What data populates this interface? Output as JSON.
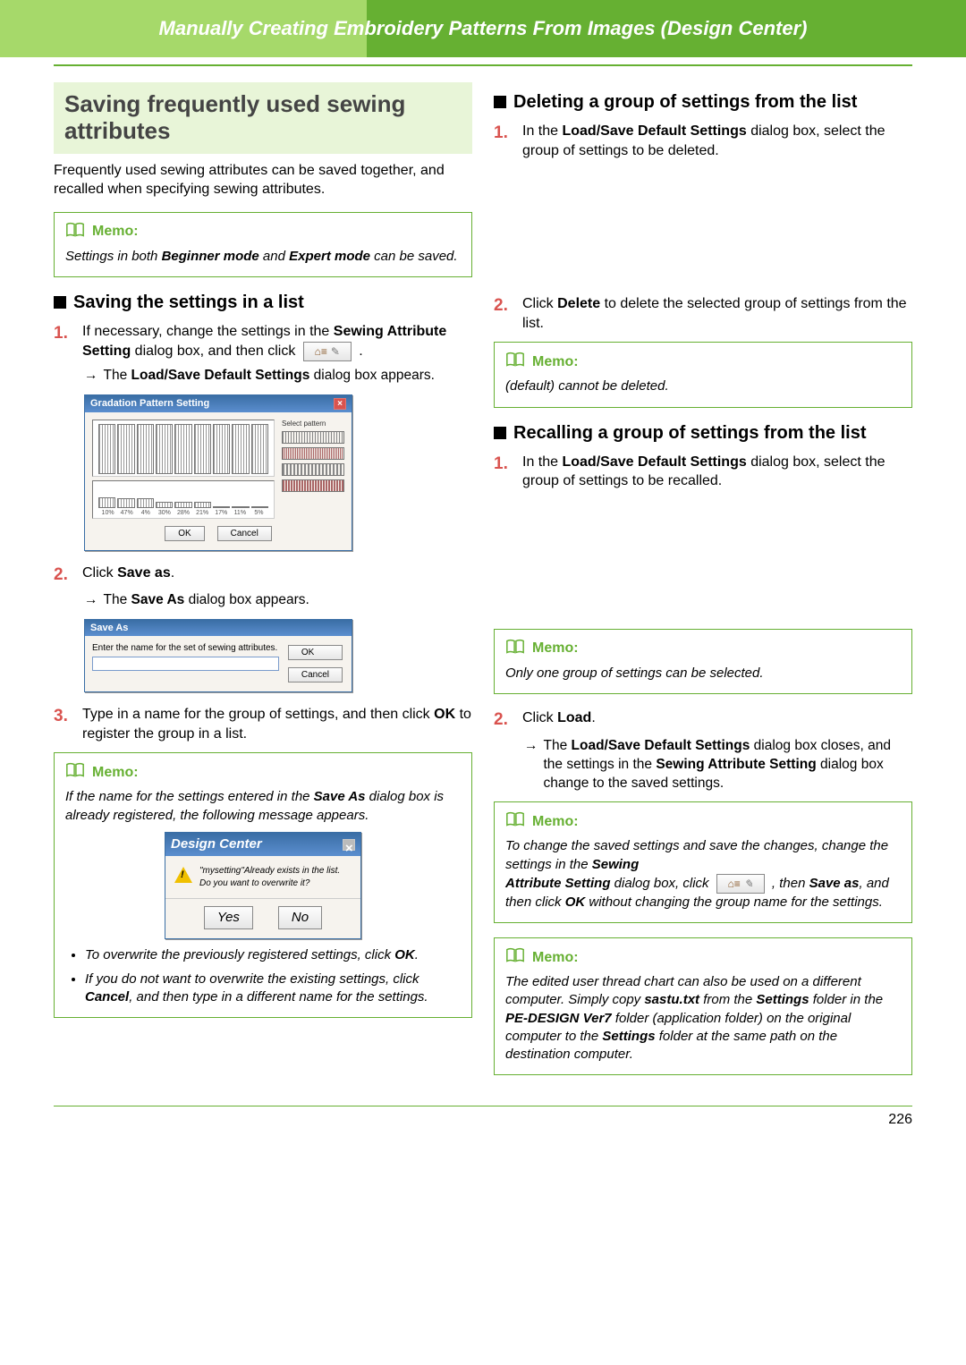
{
  "header": {
    "title": "Manually Creating Embroidery Patterns From Images (Design Center)"
  },
  "left": {
    "section_title": "Saving frequently used sewing attributes",
    "intro": "Frequently used sewing attributes can be saved together, and recalled when specifying sewing attributes.",
    "memo1_label": "Memo:",
    "memo1_body_pre": "Settings in both ",
    "memo1_b1": "Beginner mode",
    "memo1_mid": " and ",
    "memo1_b2": "Expert mode",
    "memo1_body_post": " can be saved.",
    "sub_save": "Saving the settings in a list",
    "step1_pre": "If necessary, change the settings in the ",
    "step1_b": "Sewing Attribute Setting",
    "step1_post": " dialog box, and then click ",
    "step1_tail": " .",
    "result1_pre": "The ",
    "result1_b": "Load/Save Default Settings",
    "result1_post": " dialog box appears.",
    "grad_title": "Gradation Pattern Setting",
    "grad_side_label": "Select pattern",
    "grad_labels": [
      "10%",
      "47%",
      "4%",
      "30%",
      "28%",
      "21%",
      "17%",
      "11%",
      "5%"
    ],
    "grad_ok": "OK",
    "grad_cancel": "Cancel",
    "step2_pre": "Click ",
    "step2_b": "Save as",
    "step2_post": ".",
    "result2_pre": "The ",
    "result2_b": "Save As",
    "result2_post": " dialog box appears.",
    "saveas_title": "Save As",
    "saveas_prompt": "Enter the name for the set of sewing attributes.",
    "saveas_ok": "OK",
    "saveas_cancel": "Cancel",
    "step3_pre": "Type in a name for the group of settings, and then click ",
    "step3_b": "OK",
    "step3_post": " to register the group in a list.",
    "memo2_label": "Memo:",
    "memo2_p1_pre": "If the name for the settings entered in the ",
    "memo2_p1_b": "Save As",
    "memo2_p1_post": " dialog box is already registered, the following message appears.",
    "dc_title": "Design Center",
    "dc_msg": "\"mysetting\"Already exists in the list. Do you want to overwrite it?",
    "dc_yes": "Yes",
    "dc_no": "No",
    "memo2_li1_pre": "To overwrite the previously registered settings, click ",
    "memo2_li1_b": "OK",
    "memo2_li1_post": ".",
    "memo2_li2_pre": "If you do not want to overwrite the existing settings, click ",
    "memo2_li2_b": "Cancel",
    "memo2_li2_post": ", and then type in a different name for the settings."
  },
  "right": {
    "sub_delete": "Deleting a group of settings from the list",
    "d_step1_pre": "In the ",
    "d_step1_b": "Load/Save Default Settings",
    "d_step1_post": " dialog box, select the group of settings to be deleted.",
    "d_step2_pre": "Click ",
    "d_step2_b": "Delete",
    "d_step2_post": " to delete the selected group of settings from the list.",
    "memo3_label": "Memo:",
    "memo3_body": "(default) cannot be deleted.",
    "sub_recall": "Recalling a group of settings from the list",
    "r_step1_pre": "In the ",
    "r_step1_b": "Load/Save Default Settings",
    "r_step1_post": " dialog box, select the group of settings to be recalled.",
    "memo4_label": "Memo:",
    "memo4_body": "Only one group of settings can be selected.",
    "r_step2_pre": "Click ",
    "r_step2_b": "Load",
    "r_step2_post": ".",
    "r_result_pre": "The ",
    "r_result_b1": "Load/Save Default Settings",
    "r_result_mid": " dialog box closes, and the settings in the ",
    "r_result_b2": "Sewing Attribute Setting",
    "r_result_post": " dialog box change to the saved settings.",
    "memo5_label": "Memo:",
    "memo5_p1": "To change the saved settings and save the changes, change the settings in the ",
    "memo5_b1": "Sewing",
    "memo5_p2_b": "Attribute Setting",
    "memo5_p2": " dialog box, click ",
    "memo5_p3_pre": " , then ",
    "memo5_b2": "Save as",
    "memo5_p3_mid": ", and then click ",
    "memo5_b3": "OK",
    "memo5_p3_post": " without changing the group name for the settings.",
    "memo6_label": "Memo:",
    "memo6_p_pre": "The edited user thread chart can also be used on a different computer. Simply copy ",
    "memo6_b1": "sastu.txt",
    "memo6_p_mid1": " from the ",
    "memo6_b2": "Settings",
    "memo6_p_mid2": " folder in the ",
    "memo6_b3": "PE-DESIGN Ver7",
    "memo6_p_mid3": " folder (application folder) on the original computer to the ",
    "memo6_b4": "Settings",
    "memo6_p_post": " folder at the same path on the destination computer."
  },
  "page_number": "226",
  "chart_data": {
    "type": "bar",
    "title": "Gradation Pattern Setting",
    "categories": [
      "10%",
      "47%",
      "4%",
      "30%",
      "28%",
      "21%",
      "17%",
      "11%",
      "5%"
    ],
    "top_values": [
      100,
      100,
      100,
      100,
      100,
      100,
      100,
      100,
      100
    ],
    "bottom_values": [
      45,
      40,
      40,
      25,
      25,
      25,
      8,
      8,
      3
    ],
    "xlabel": "",
    "ylabel": "",
    "ylim": [
      0,
      100
    ]
  }
}
